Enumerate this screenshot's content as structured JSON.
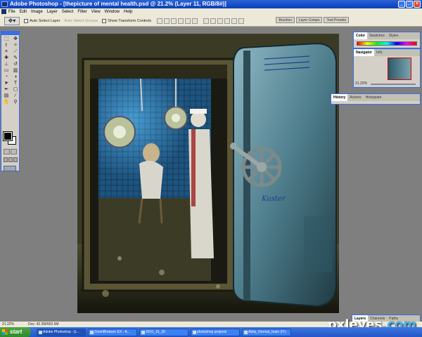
{
  "window": {
    "title": "Adobe Photoshop - [thepicture of mental health.psd @ 21.2% (Layer 11, RGB/8#)]"
  },
  "menu": [
    "File",
    "Edit",
    "Image",
    "Layer",
    "Select",
    "Filter",
    "View",
    "Window",
    "Help"
  ],
  "options": {
    "auto_select_layer": "Auto Select Layer",
    "auto_select_groups": "Auto Select Groups",
    "show_transform_controls": "Show Transform Controls"
  },
  "palette_well": [
    "Brushes",
    "Layer Comps",
    "Tool Presets"
  ],
  "panels": {
    "color": [
      "Color",
      "Swatches",
      "Styles"
    ],
    "navigator": [
      "Navigator",
      "Info"
    ],
    "navigator_zoom": "21.22%",
    "history": [
      "History",
      "Actions",
      "Histogram"
    ],
    "layers": [
      "Layers",
      "Channels",
      "Paths"
    ]
  },
  "status": {
    "zoom": "21.22%",
    "doc": "Doc: 42.2M/902.6M"
  },
  "artwork": {
    "door_text": "Kuster"
  },
  "taskbar": {
    "start": "start",
    "items": [
      "Adobe Photoshop - [t...",
      "ZoomBrowser EX - A...",
      "2010_10_30",
      "photoshop projects",
      "Abby_Normal_brain (H:)"
    ]
  },
  "watermark": {
    "brand": "pxleyes",
    "suffix": ".com"
  }
}
